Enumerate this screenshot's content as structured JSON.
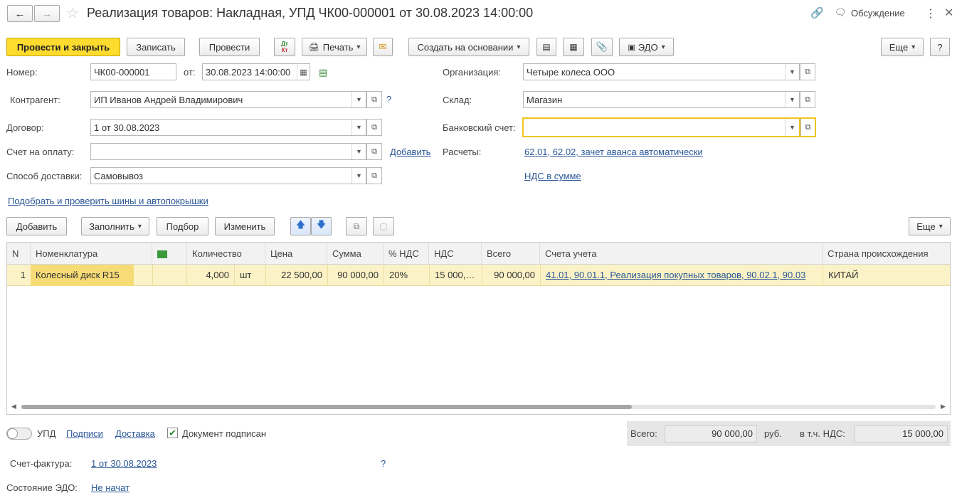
{
  "window": {
    "title": "Реализация товаров: Накладная, УПД ЧК00-000001 от 30.08.2023 14:00:00",
    "discussion_label": "Обсуждение"
  },
  "toolbar": {
    "post_close": "Провести и закрыть",
    "save": "Записать",
    "post": "Провести",
    "dtkt_top": "Дт",
    "dtkt_bottom": "Кт",
    "print": "Печать",
    "create_based": "Создать на основании",
    "edo": "ЭДО",
    "more": "Еще",
    "help": "?"
  },
  "form": {
    "number_label": "Номер:",
    "number_value": "ЧК00-000001",
    "date_label": "от:",
    "date_value": "30.08.2023 14:00:00",
    "org_label": "Организация:",
    "org_value": "Четыре колеса ООО",
    "contractor_label": "Контрагент:",
    "contractor_value": "ИП Иванов Андрей Владимирович",
    "contractor_help": "?",
    "warehouse_label": "Склад:",
    "warehouse_value": "Магазин",
    "contract_label": "Договор:",
    "contract_value": "1 от 30.08.2023",
    "bank_label": "Банковский счет:",
    "bank_value": "",
    "invoice_label": "Счет на оплату:",
    "invoice_value": "",
    "add_link": "Добавить",
    "settlements_label": "Расчеты:",
    "settlements_link": "62.01, 62.02, зачет аванса автоматически",
    "delivery_label": "Способ доставки:",
    "delivery_value": "Самовывоз",
    "vat_link": "НДС в сумме",
    "tires_link": "Подобрать и проверить шины и автопокрышки"
  },
  "table_toolbar": {
    "add": "Добавить",
    "fill": "Заполнить",
    "pick": "Подбор",
    "change": "Изменить",
    "more": "Еще"
  },
  "table": {
    "headers": {
      "n": "N",
      "item": "Номенклатура",
      "qty": "Количество",
      "price": "Цена",
      "sum": "Сумма",
      "vat_pct": "% НДС",
      "vat": "НДС",
      "total": "Всего",
      "accounts": "Счета учета",
      "country": "Страна происхождения"
    },
    "rows": [
      {
        "n": "1",
        "item": "Колесный диск R15",
        "qty": "4,000",
        "unit": "шт",
        "price": "22 500,00",
        "sum": "90 000,00",
        "vat_pct": "20%",
        "vat": "15 000,…",
        "total": "90 000,00",
        "accounts": "41.01, 90.01.1, Реализация покупных товаров, 90.02.1, 90.03",
        "country": "КИТАЙ"
      }
    ]
  },
  "footer": {
    "upd_label": "УПД",
    "signatures_link": "Подписи",
    "delivery_link": "Доставка",
    "signed_label": "Документ подписан",
    "total_label": "Всего:",
    "total_value": "90 000,00",
    "currency": "руб.",
    "vat_incl_label": "в т.ч. НДС:",
    "vat_incl_value": "15 000,00",
    "invoice_doc_label": "Счет-фактура:",
    "invoice_doc_link": "1 от 30.08.2023",
    "invoice_help": "?",
    "edo_state_label": "Состояние ЭДО:",
    "edo_state_link": "Не начат"
  },
  "colors": {
    "primary_button": "#fddc2f",
    "selected_row": "#fbf3c7",
    "link": "#2b5797",
    "focus_border": "#f0c420"
  }
}
